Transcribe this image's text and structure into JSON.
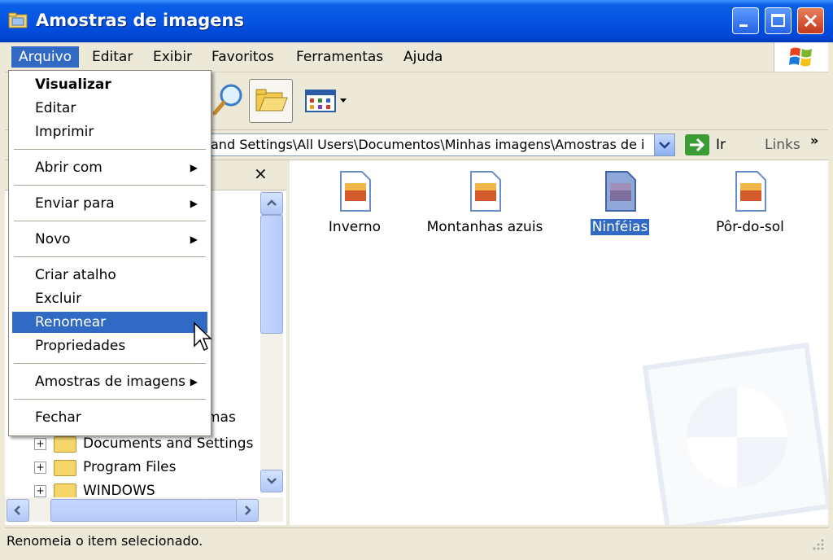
{
  "window": {
    "title": "Amostras de imagens"
  },
  "menubar": {
    "items": [
      "Arquivo",
      "Editar",
      "Exibir",
      "Favoritos",
      "Ferramentas",
      "Ajuda"
    ]
  },
  "address": {
    "value": "and Settings\\All Users\\Documentos\\Minhas imagens\\Amostras de i",
    "go_label": "Ir",
    "links_label": "Links",
    "links_chevron": "»"
  },
  "left_pane": {
    "close_glyph": "×",
    "partial_label": "mas",
    "tree": [
      {
        "label": "Documents and Settings",
        "expander": "+"
      },
      {
        "label": "Program Files",
        "expander": "+"
      },
      {
        "label": "WINDOWS",
        "expander": "+"
      }
    ]
  },
  "files": [
    {
      "name": "Inverno",
      "selected": false
    },
    {
      "name": "Montanhas azuis",
      "selected": false
    },
    {
      "name": "Ninféias",
      "selected": true
    },
    {
      "name": "Pôr-do-sol",
      "selected": false
    }
  ],
  "file_menu": {
    "items": {
      "visualizar": "Visualizar",
      "editar": "Editar",
      "imprimir": "Imprimir",
      "abrir_com": "Abrir com",
      "enviar_para": "Enviar para",
      "novo": "Novo",
      "criar_atalho": "Criar atalho",
      "excluir": "Excluir",
      "renomear": "Renomear",
      "propriedades": "Propriedades",
      "amostras": "Amostras de imagens",
      "fechar": "Fechar"
    },
    "submenu_arrow": "▶",
    "highlighted": "Renomear"
  },
  "status": {
    "text": "Renomeia o item selecionado."
  },
  "colors": {
    "selection": "#316ac5",
    "titlebar": "#0554e3",
    "chrome": "#ece9d8"
  }
}
